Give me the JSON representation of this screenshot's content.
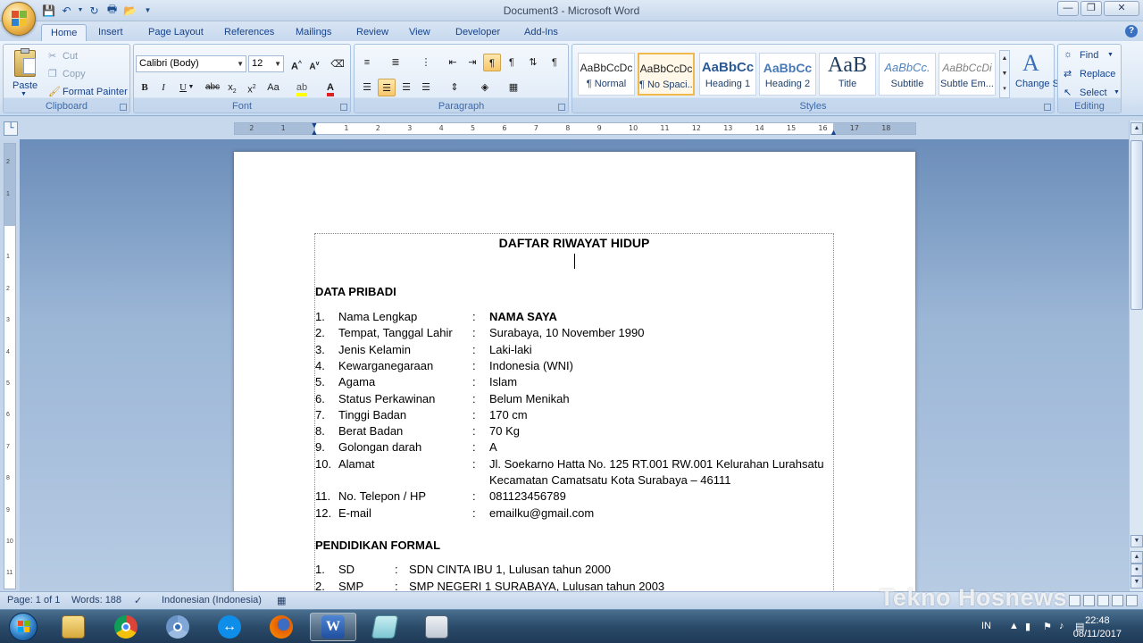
{
  "window": {
    "title": "Document3 - Microsoft Word"
  },
  "quick_access": [
    "save-icon",
    "undo-icon",
    "redo-icon",
    "print-preview-icon",
    "open-icon",
    "customize-icon"
  ],
  "tabs": [
    "Home",
    "Insert",
    "Page Layout",
    "References",
    "Mailings",
    "Review",
    "View",
    "Developer",
    "Add-Ins"
  ],
  "active_tab": "Home",
  "ribbon": {
    "clipboard": {
      "label": "Clipboard",
      "paste": "Paste",
      "cut": "Cut",
      "copy": "Copy",
      "format_painter": "Format Painter"
    },
    "font": {
      "label": "Font",
      "font_name": "Calibri (Body)",
      "font_size": "12"
    },
    "paragraph": {
      "label": "Paragraph"
    },
    "styles": {
      "label": "Styles",
      "cards": [
        {
          "sample": "AaBbCcDc",
          "name": "¶ Normal"
        },
        {
          "sample": "AaBbCcDc",
          "name": "¶ No Spaci..."
        },
        {
          "sample": "AaBbCc",
          "name": "Heading 1"
        },
        {
          "sample": "AaBbCc",
          "name": "Heading 2"
        },
        {
          "sample": "AaB",
          "name": "Title"
        },
        {
          "sample": "AaBbCc.",
          "name": "Subtitle"
        },
        {
          "sample": "AaBbCcDi",
          "name": "Subtle Em..."
        }
      ],
      "change_styles": "Change Styles"
    },
    "editing": {
      "label": "Editing",
      "find": "Find",
      "replace": "Replace",
      "select": "Select"
    }
  },
  "ruler": {
    "ticks": [
      "2",
      "1",
      "1",
      "2",
      "3",
      "4",
      "5",
      "6",
      "7",
      "8",
      "9",
      "10",
      "11",
      "12",
      "13",
      "14",
      "15",
      "16",
      "17",
      "18"
    ]
  },
  "vruler": {
    "ticks": [
      "2",
      "1",
      "1",
      "2",
      "3",
      "4",
      "5",
      "6",
      "7",
      "8",
      "9",
      "10",
      "11"
    ]
  },
  "document": {
    "heading": "DAFTAR RIWAYAT HIDUP",
    "section1_title": "DATA PRIBADI",
    "personal": [
      {
        "num": "1.",
        "label": "Nama Lengkap",
        "value": "NAMA SAYA",
        "bold": true
      },
      {
        "num": "2.",
        "label": "Tempat, Tanggal Lahir",
        "value": "Surabaya, 10 November 1990"
      },
      {
        "num": "3.",
        "label": "Jenis Kelamin",
        "value": "Laki-laki"
      },
      {
        "num": "4.",
        "label": "Kewarganegaraan",
        "value": "Indonesia (WNI)"
      },
      {
        "num": "5.",
        "label": "Agama",
        "value": "Islam"
      },
      {
        "num": "6.",
        "label": "Status Perkawinan",
        "value": "Belum Menikah"
      },
      {
        "num": "7.",
        "label": "Tinggi Badan",
        "value": "170 cm"
      },
      {
        "num": "8.",
        "label": "Berat Badan",
        "value": "70 Kg"
      },
      {
        "num": "9.",
        "label": "Golongan darah",
        "value": "A"
      },
      {
        "num": "10.",
        "label": "Alamat",
        "value": "Jl. Soekarno Hatta No. 125 RT.001 RW.001 Kelurahan Lurahsatu",
        "value2": "Kecamatan Camatsatu Kota Surabaya – 46111"
      },
      {
        "num": "11.",
        "label": "No. Telepon / HP",
        "value": "081123456789"
      },
      {
        "num": "12.",
        "label": "E-mail",
        "value": "emailku@gmail.com"
      }
    ],
    "colon": ":",
    "section2_title": "PENDIDIKAN FORMAL",
    "education": [
      {
        "num": "1.",
        "label": "SD",
        "value": "SDN CINTA IBU 1, Lulusan tahun 2000"
      },
      {
        "num": "2.",
        "label": "SMP",
        "value": "SMP NEGERI 1 SURABAYA, Lulusan tahun 2003"
      }
    ]
  },
  "status": {
    "page": "Page: 1 of 1",
    "words": "Words: 188",
    "language": "Indonesian (Indonesia)"
  },
  "watermark": "Tekno Hosnews",
  "taskbar": {
    "apps": [
      "windows-explorer-icon",
      "chrome-icon",
      "chrome-icon",
      "teamviewer-icon",
      "firefox-icon",
      "word-icon",
      "notepad-icon",
      "calculator-icon"
    ],
    "lang": "IN",
    "time": "22:48",
    "date": "08/11/2017"
  }
}
